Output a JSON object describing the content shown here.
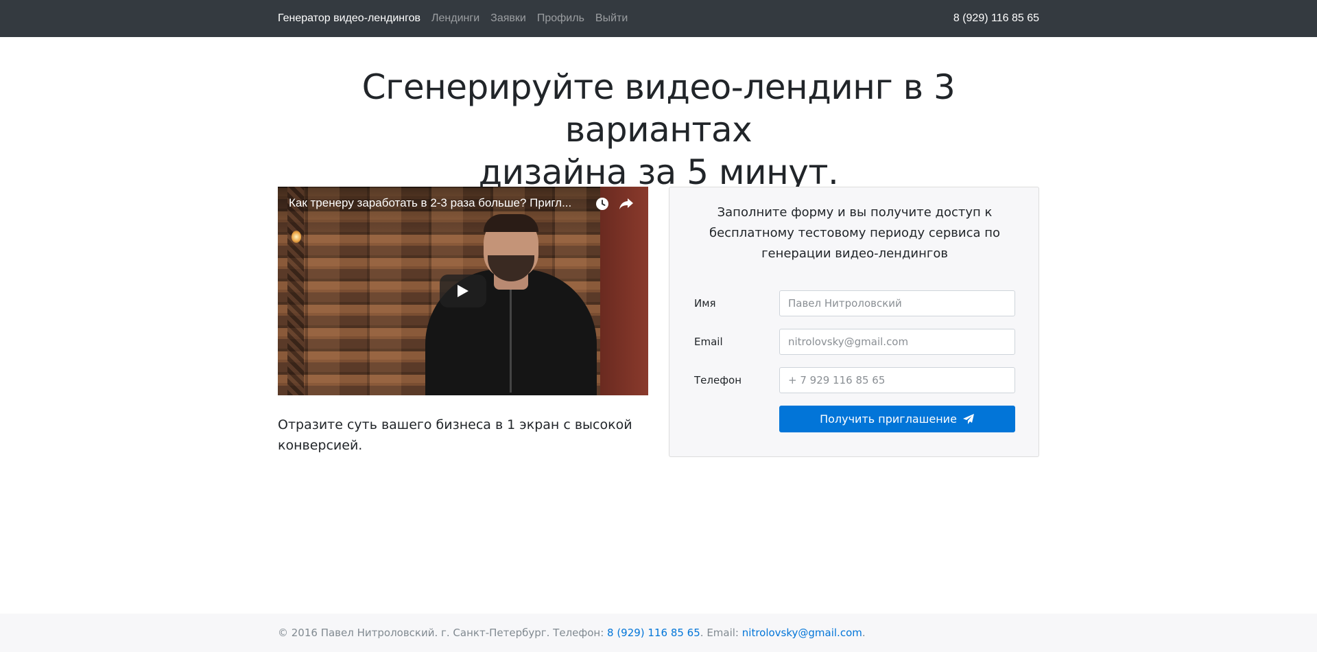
{
  "navbar": {
    "brand": "Генератор видео-лендингов",
    "links": [
      "Лендинги",
      "Заявки",
      "Профиль",
      "Выйти"
    ],
    "phone": "8 (929) 116 85 65"
  },
  "hero": {
    "line1": "Сгенерируйте видео-лендинг в 3 вариантах",
    "line2": "дизайна за 5 минут."
  },
  "video": {
    "title": "Как тренеру заработать в 2-3 раза больше? Пригл..."
  },
  "caption": "Отразите суть вашего бизнеса в 1 экран с высокой конверсией.",
  "form": {
    "intro": "Заполните форму и вы получите доступ к бесплатному тестовому периоду сервиса по генерации видео-лендингов",
    "fields": [
      {
        "label": "Имя",
        "placeholder": "Павел Нитроловский"
      },
      {
        "label": "Email",
        "placeholder": "nitrolovsky@gmail.com"
      },
      {
        "label": "Телефон",
        "placeholder": "+ 7 929 116 85 65"
      }
    ],
    "submit_label": "Получить приглашение"
  },
  "footer": {
    "prefix": "© 2016 Павел Нитроловский. г. Санкт-Петербург. Телефон: ",
    "phone": "8 (929) 116 85 65",
    "middle": ". Email: ",
    "email": "nitrolovsky@gmail.com",
    "suffix": "."
  },
  "colors": {
    "navbar_bg": "#343a40",
    "primary": "#0275d8",
    "card_bg": "#f7f7f9",
    "footer_bg": "#f7f7f9"
  }
}
